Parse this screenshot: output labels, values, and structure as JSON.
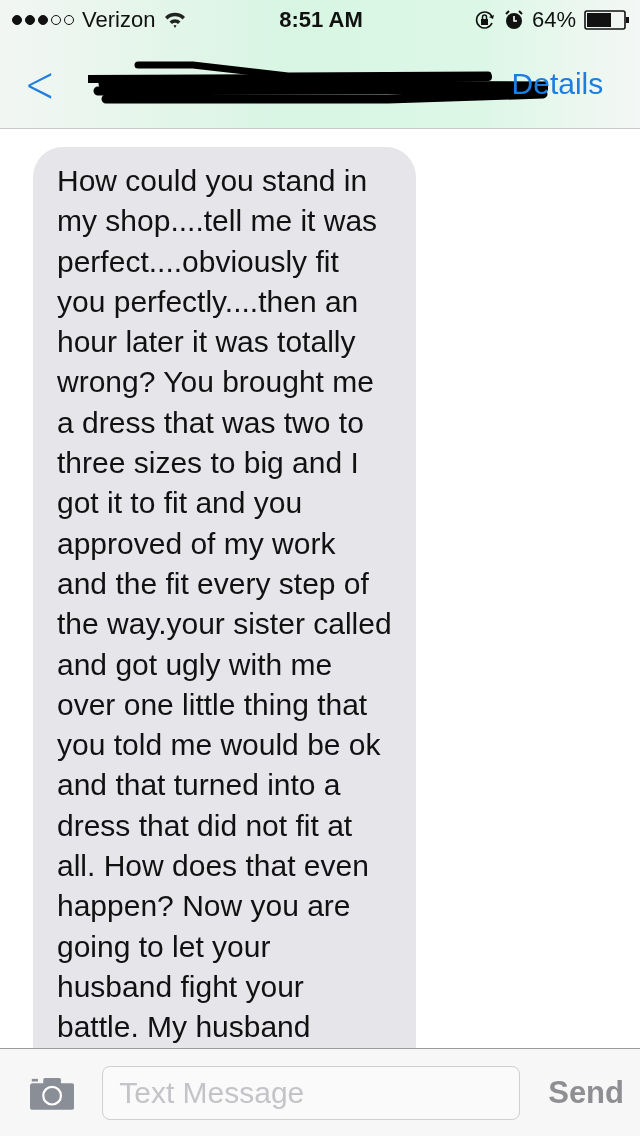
{
  "status_bar": {
    "signal_dots": [
      {
        "filled": true
      },
      {
        "filled": true
      },
      {
        "filled": true
      },
      {
        "filled": false
      },
      {
        "filled": false
      }
    ],
    "carrier": "Verizon",
    "time": "8:51 AM",
    "battery": "64%"
  },
  "nav_bar": {
    "back": "<",
    "details": "Details"
  },
  "messages": [
    {
      "kind": "received",
      "text": "How could you stand in\nmy shop....tell me it was\nperfect....obviously fit\nyou perfectly....then an\nhour later it was totally\nwrong? You brought me\na dress that was two to\nthree sizes to big and I\ngot it to fit and you\napproved of my work\nand the fit every step of\nthe way.your sister called\nand got ugly with me\nover one little thing that\nyou told me would be ok\nand that turned into a\ndress that did not fit at\nall. How does that even\nhappen? Now you are\ngoing to let your\nhusband fight your\nbattle. My husband"
    }
  ],
  "input_bar": {
    "placeholder": "Text Message",
    "send": "Send"
  }
}
